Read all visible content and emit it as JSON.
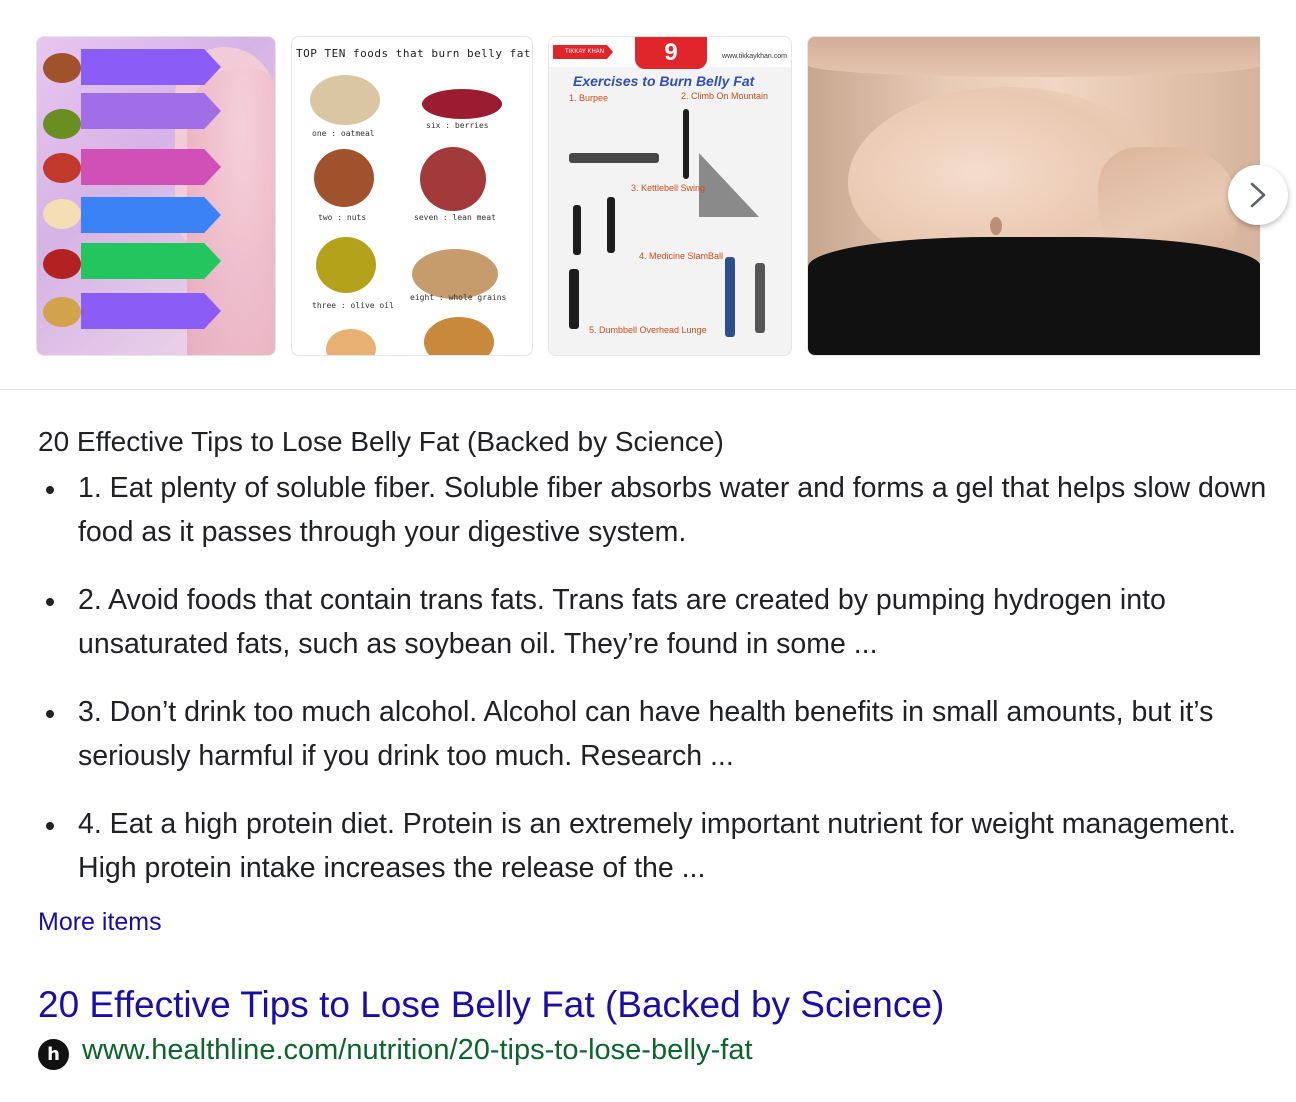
{
  "carousel": {
    "images": [
      {
        "name": "foods-to-burn-belly-fat-infographic"
      },
      {
        "name": "top-ten-foods-that-burn-belly-fat",
        "heading": "TOP TEN foods that burn belly fat",
        "labels": [
          "one : oatmeal",
          "six : berries",
          "two : nuts",
          "seven : lean meat",
          "three : olive oil",
          "eight : whole grains"
        ]
      },
      {
        "name": "exercises-to-burn-belly-fat",
        "number": "9",
        "brand": "TIKKAY KHAN",
        "site": "www.tikkaykhan.com",
        "heading": "Exercises to Burn Belly Fat",
        "items": [
          "1. Burpee",
          "2. Climb On Mountain",
          "3. Kettlebell Swing",
          "4. Medicine SlamBall",
          "5. Dumbbell Overhead Lunge"
        ]
      },
      {
        "name": "belly-fat-photo"
      }
    ],
    "next_icon": "chevron-right-icon"
  },
  "snippet": {
    "title": "20 Effective Tips to Lose Belly Fat (Backed by Science)",
    "bullets": [
      "1. Eat plenty of soluble fiber. Soluble fiber absorbs water and forms a gel that helps slow down food as it passes through your digestive system.",
      "2. Avoid foods that contain trans fats. Trans fats are created by pumping hydrogen into unsaturated fats, such as soybean oil. They’re found in some ...",
      "3. Don’t drink too much alcohol. Alcohol can have health benefits in small amounts, but it’s seriously harmful if you drink too much. Research ...",
      "4. Eat a high protein diet. Protein is an extremely important nutrient for weight management. High protein intake increases the release of the ..."
    ],
    "more_items": "More items"
  },
  "result": {
    "title": "20 Effective Tips to Lose Belly Fat (Backed by Science)",
    "url": "www.healthline.com/nutrition/20-tips-to-lose-belly-fat",
    "favicon_letter": "h"
  },
  "colors": {
    "link": "#1a0dab",
    "url": "#0d652d",
    "text": "#202124"
  }
}
